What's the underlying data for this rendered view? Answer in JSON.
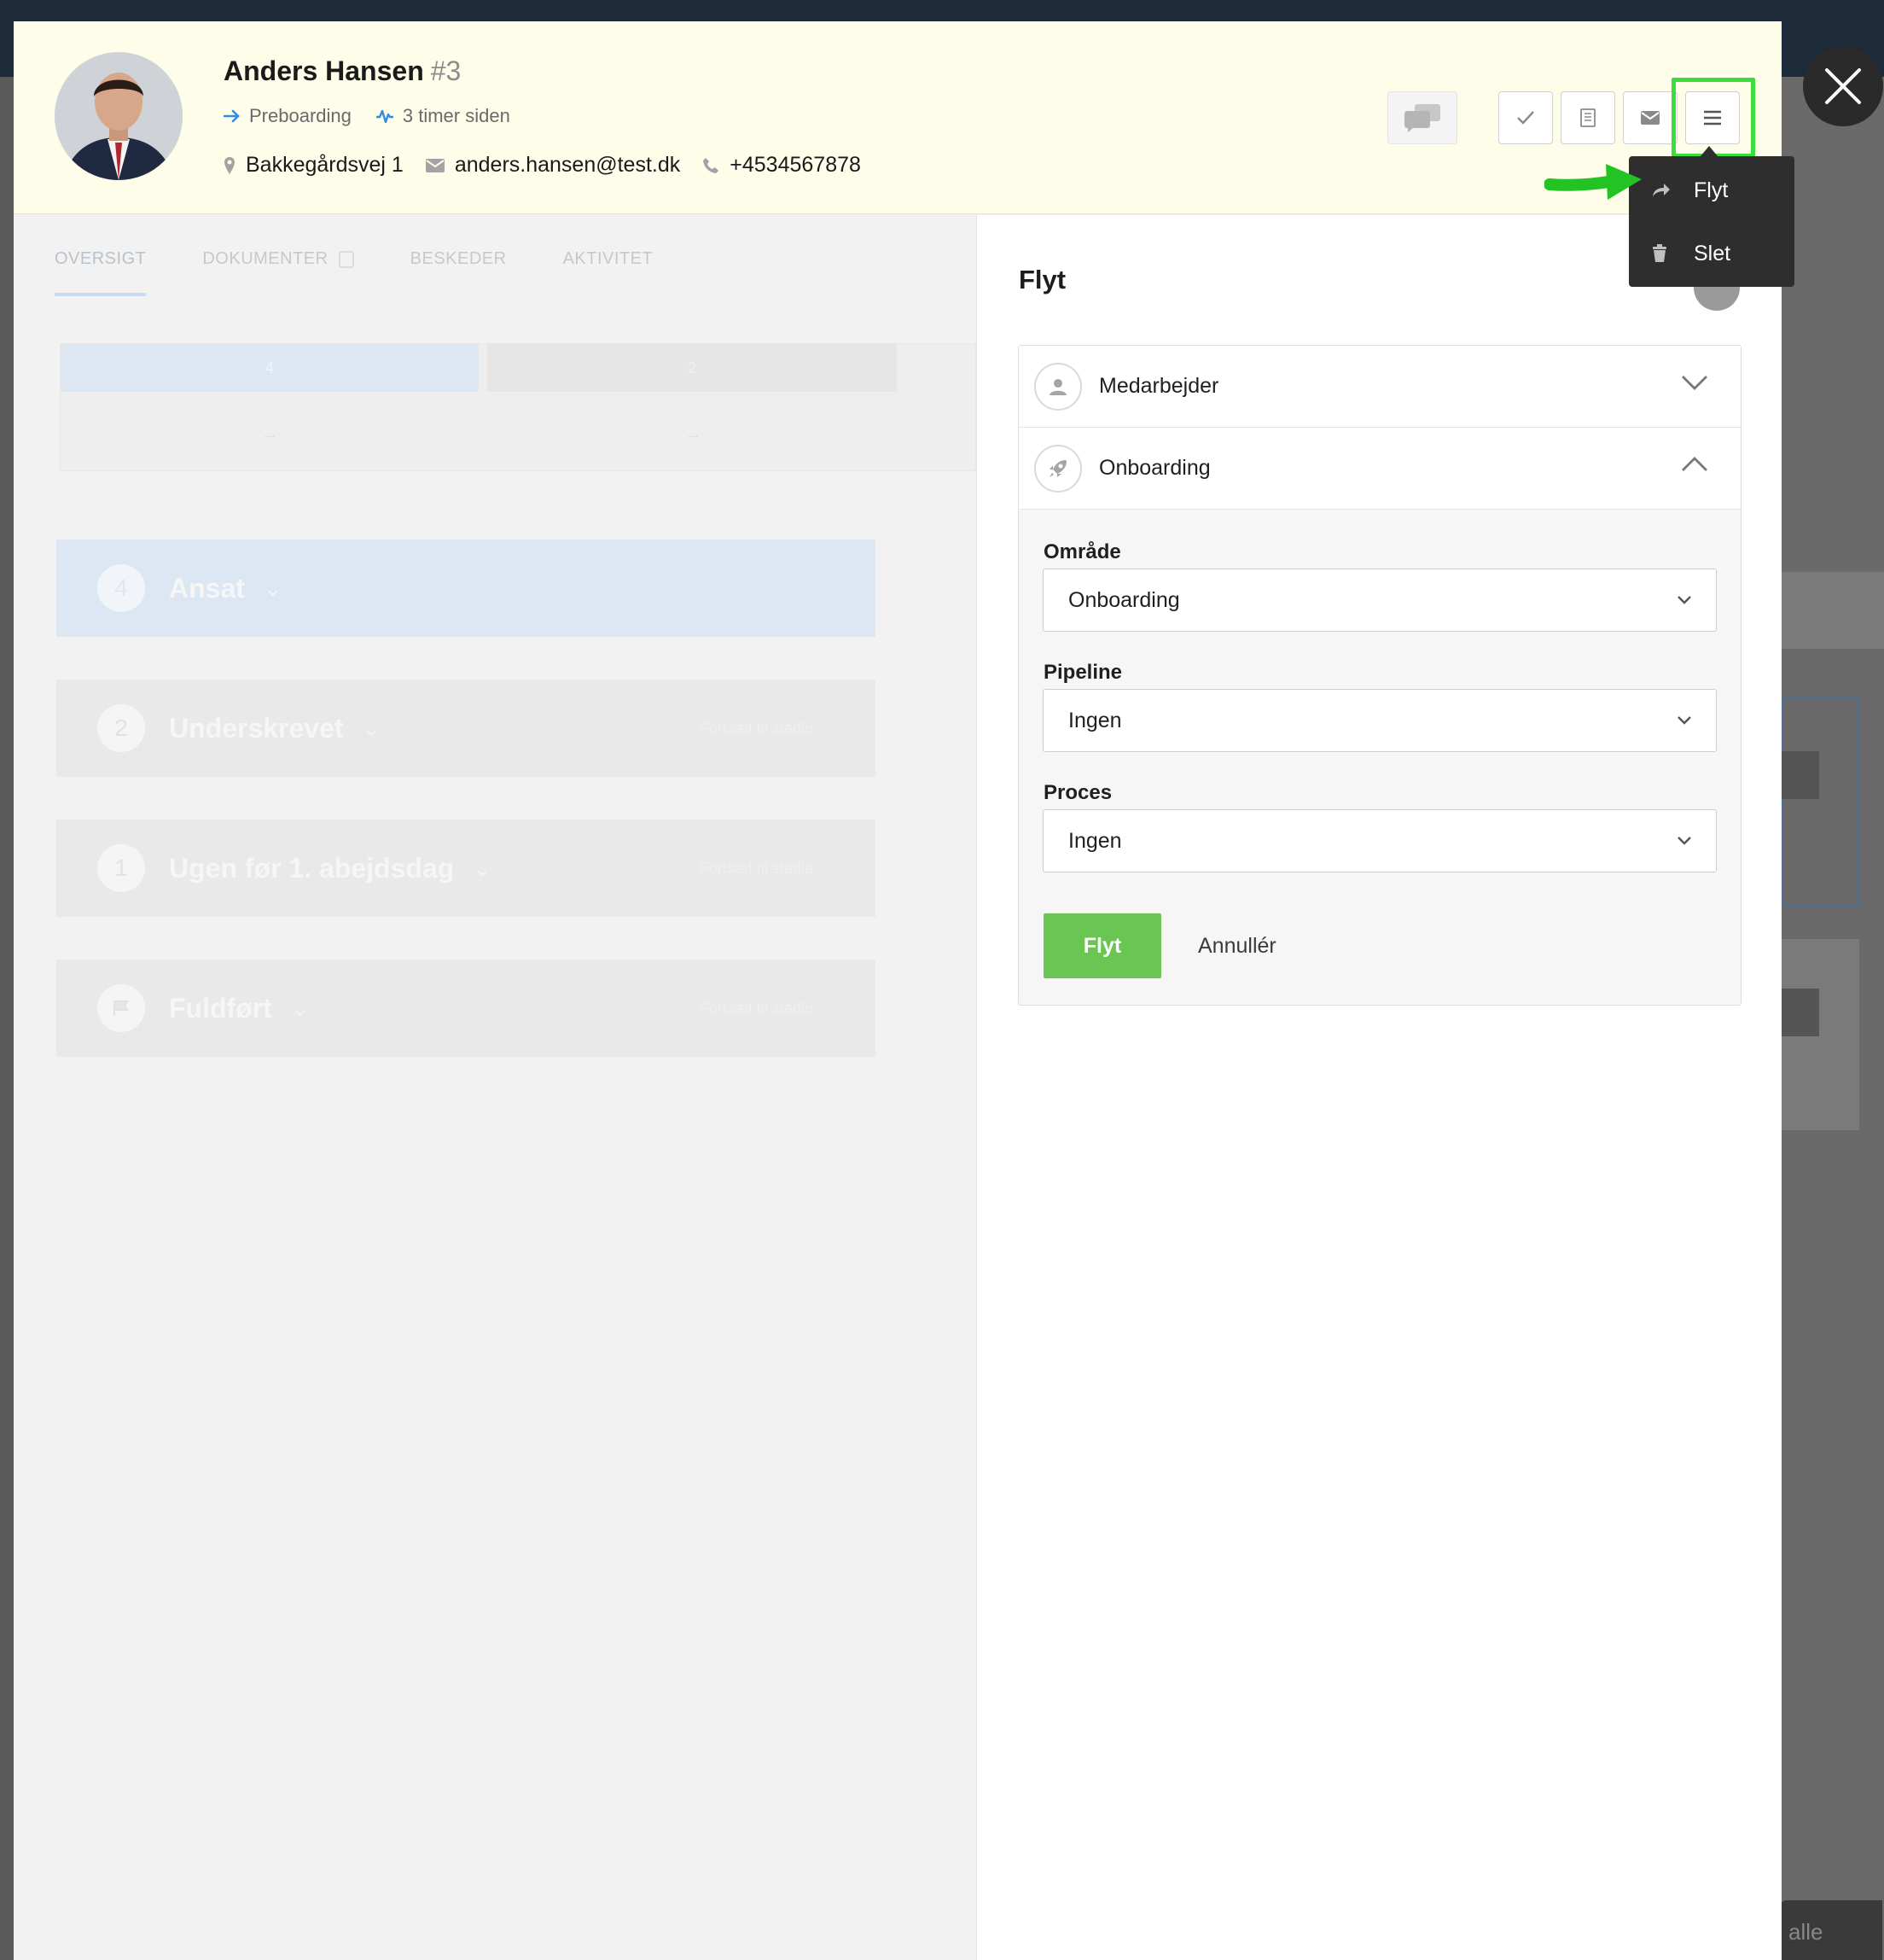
{
  "profile": {
    "name": "Anders Hansen",
    "number": "#3",
    "stage": "Preboarding",
    "activity": "3 timer siden",
    "address": "Bakkegårdsvej 1",
    "email": "anders.hansen@test.dk",
    "phone": "+4534567878"
  },
  "tabs": [
    {
      "label": "OVERSIGT",
      "active": true
    },
    {
      "label": "DOKUMENTER",
      "active": false
    },
    {
      "label": "BESKEDER",
      "active": false
    },
    {
      "label": "AKTIVITET",
      "active": false
    }
  ],
  "progress": {
    "seg1": "4",
    "seg2": "2"
  },
  "stages": [
    {
      "num": "4",
      "title": "Ansat",
      "cont": ""
    },
    {
      "num": "2",
      "title": "Underskrevet",
      "cont": "Fortsæt til stadie"
    },
    {
      "num": "1",
      "title": "Ugen før 1. abejdsdag",
      "cont": "Fortsæt til stadie"
    },
    {
      "num": "",
      "title": "Fuldført",
      "cont": "Fortsæt til stadie"
    }
  ],
  "menu": {
    "items": [
      {
        "label": "Flyt",
        "icon": "share-arrow-icon"
      },
      {
        "label": "Slet",
        "icon": "trash-icon"
      }
    ]
  },
  "panel": {
    "title": "Flyt",
    "sections": [
      {
        "label": "Medarbejder",
        "icon": "user-icon",
        "expanded": false
      },
      {
        "label": "Onboarding",
        "icon": "rocket-icon",
        "expanded": true
      }
    ],
    "fields": [
      {
        "label": "Område",
        "value": "Onboarding"
      },
      {
        "label": "Pipeline",
        "value": "Ingen"
      },
      {
        "label": "Proces",
        "value": "Ingen"
      }
    ],
    "submit": "Flyt",
    "cancel": "Annullér"
  },
  "background": {
    "bottom_button": "alle"
  },
  "colors": {
    "header_bg": "#fdfde9",
    "primary_green": "#6ac552",
    "highlight_green": "#3bdc3b",
    "link_blue": "#2f8de4"
  }
}
